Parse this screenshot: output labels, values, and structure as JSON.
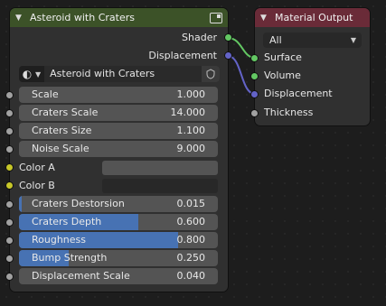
{
  "group_node": {
    "title": "Asteroid with Craters",
    "header_icon": "node-group-icon",
    "outputs": [
      {
        "label": "Shader",
        "color": "#63c763"
      },
      {
        "label": "Displacement",
        "color": "#6363c7"
      }
    ],
    "group_selector": {
      "icon": "material-sphere-icon",
      "name": "Asteroid with Craters",
      "fake_user_icon": "shield-icon"
    },
    "inputs": [
      {
        "label": "Scale",
        "value": "1.000",
        "fill": 0
      },
      {
        "label": "Craters Scale",
        "value": "14.000",
        "fill": 0
      },
      {
        "label": "Craters Size",
        "value": "1.100",
        "fill": 0
      },
      {
        "label": "Noise Scale",
        "value": "9.000",
        "fill": 0
      }
    ],
    "colors": [
      {
        "label": "Color A",
        "swatch": "#545454"
      },
      {
        "label": "Color B",
        "swatch": "#282828"
      }
    ],
    "factors": [
      {
        "label": "Craters Destorsion",
        "value": "0.015",
        "fill": 0.015
      },
      {
        "label": "Craters Depth",
        "value": "0.600",
        "fill": 0.6
      },
      {
        "label": "Roughness",
        "value": "0.800",
        "fill": 0.8
      },
      {
        "label": "Bump Strength",
        "value": "0.250",
        "fill": 0.25
      },
      {
        "label": "Displacement Scale",
        "value": "0.040",
        "fill": 0
      }
    ]
  },
  "output_node": {
    "title": "Material Output",
    "target": "All",
    "inputs": [
      {
        "label": "Surface",
        "color": "#63c763"
      },
      {
        "label": "Volume",
        "color": "#63c763"
      },
      {
        "label": "Displacement",
        "color": "#6363c7"
      },
      {
        "label": "Thickness",
        "color": "#a1a1a1"
      }
    ]
  },
  "socket_colors": {
    "float": "#a1a1a1",
    "color": "#c7c729",
    "shader": "#63c763",
    "vector": "#6363c7"
  }
}
